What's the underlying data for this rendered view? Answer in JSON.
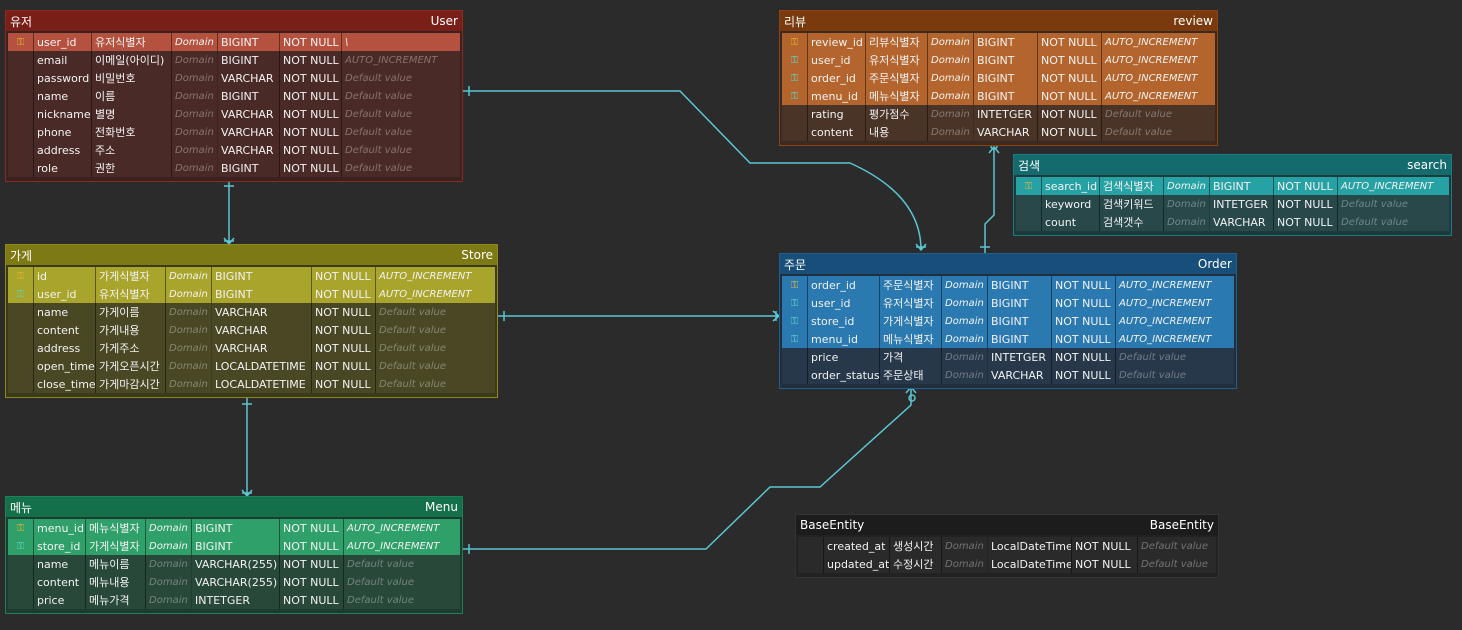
{
  "theme": {
    "user": {
      "header": "#7a1f17",
      "body": "#3a2220",
      "border": "#8c2a20",
      "key": "#b5523f",
      "col": "#4a2a27",
      "pk": "#e5b335",
      "fk": "#e5b335"
    },
    "store": {
      "header": "#7d7914",
      "body": "#3b3a1d",
      "border": "#8e8a1a",
      "key": "#a9a42c",
      "col": "#4a4824",
      "pk": "#e5b335",
      "fk": "#5fd3c9"
    },
    "menu": {
      "header": "#13704a",
      "body": "#1f3a2e",
      "border": "#1b8156",
      "key": "#2fa06a",
      "col": "#28483a",
      "pk": "#e5b335",
      "fk": "#5fd3c9"
    },
    "review": {
      "header": "#7a3a0d",
      "body": "#3a2a20",
      "border": "#8e4412",
      "key": "#b3652d",
      "col": "#4a3428",
      "pk": "#e5b335",
      "fk": "#5fd3c9"
    },
    "search": {
      "header": "#136b6d",
      "body": "#1f3a3b",
      "border": "#1a7c7e",
      "key": "#26a2a4",
      "col": "#284849",
      "pk": "#e5b335",
      "fk": "#5fd3c9"
    },
    "order": {
      "header": "#174f7a",
      "body": "#1f2f3b",
      "border": "#1e5f92",
      "key": "#2a79b0",
      "col": "#27384a",
      "pk": "#e5b335",
      "fk": "#5fd3c9"
    },
    "base": {
      "header": "#1c1c1c",
      "body": "#222222",
      "border": "#333333",
      "key": "#2f2f2f",
      "col": "#2a2a2a",
      "pk": "#888888",
      "fk": "#888888"
    },
    "line": "#5bc6d1"
  },
  "entities": [
    {
      "id": "user",
      "label_ko": "유저",
      "label_en": "User",
      "rows": [
        {
          "key": "pk",
          "name": "user_id",
          "logical": "유저식별자",
          "domain": "Domain",
          "type": "BIGINT",
          "null": "NOT NULL",
          "default": "\\"
        },
        {
          "key": "",
          "name": "email",
          "logical": "이메일(아이디)",
          "domain": "Domain",
          "type": "BIGINT",
          "null": "NOT NULL",
          "default": "AUTO_INCREMENT"
        },
        {
          "key": "",
          "name": "password",
          "logical": "비밀번호",
          "domain": "Domain",
          "type": "VARCHAR",
          "null": "NOT NULL",
          "default": "Default value"
        },
        {
          "key": "",
          "name": "name",
          "logical": "이름",
          "domain": "Domain",
          "type": "BIGINT",
          "null": "NOT NULL",
          "default": "Default value"
        },
        {
          "key": "",
          "name": "nickname",
          "logical": "별명",
          "domain": "Domain",
          "type": "VARCHAR",
          "null": "NOT NULL",
          "default": "Default value"
        },
        {
          "key": "",
          "name": "phone",
          "logical": "전화번호",
          "domain": "Domain",
          "type": "VARCHAR",
          "null": "NOT NULL",
          "default": "Default value"
        },
        {
          "key": "",
          "name": "address",
          "logical": "주소",
          "domain": "Domain",
          "type": "VARCHAR",
          "null": "NOT NULL",
          "default": "Default value"
        },
        {
          "key": "",
          "name": "role",
          "logical": "권한",
          "domain": "Domain",
          "type": "BIGINT",
          "null": "NOT NULL",
          "default": "Default value"
        }
      ]
    },
    {
      "id": "store",
      "label_ko": "가게",
      "label_en": "Store",
      "rows": [
        {
          "key": "pk",
          "name": "id",
          "logical": "가게식별자",
          "domain": "Domain",
          "type": "BIGINT",
          "null": "NOT NULL",
          "default": "AUTO_INCREMENT"
        },
        {
          "key": "fk",
          "name": "user_id",
          "logical": "유저식별자",
          "domain": "Domain",
          "type": "BIGINT",
          "null": "NOT NULL",
          "default": "AUTO_INCREMENT"
        },
        {
          "key": "",
          "name": "name",
          "logical": "가게이름",
          "domain": "Domain",
          "type": "VARCHAR",
          "null": "NOT NULL",
          "default": "Default value"
        },
        {
          "key": "",
          "name": "content",
          "logical": "가게내용",
          "domain": "Domain",
          "type": "VARCHAR",
          "null": "NOT NULL",
          "default": "Default value"
        },
        {
          "key": "",
          "name": "address",
          "logical": "가게주소",
          "domain": "Domain",
          "type": "VARCHAR",
          "null": "NOT NULL",
          "default": "Default value"
        },
        {
          "key": "",
          "name": "open_time",
          "logical": "가게오픈시간",
          "domain": "Domain",
          "type": "LOCALDATETIME",
          "null": "NOT NULL",
          "default": "Default value"
        },
        {
          "key": "",
          "name": "close_time",
          "logical": "가게마감시간",
          "domain": "Domain",
          "type": "LOCALDATETIME",
          "null": "NOT NULL",
          "default": "Default value"
        }
      ]
    },
    {
      "id": "menu",
      "label_ko": "메뉴",
      "label_en": "Menu",
      "rows": [
        {
          "key": "pk",
          "name": "menu_id",
          "logical": "메뉴식별자",
          "domain": "Domain",
          "type": "BIGINT",
          "null": "NOT NULL",
          "default": "AUTO_INCREMENT"
        },
        {
          "key": "fk",
          "name": "store_id",
          "logical": "가게식별자",
          "domain": "Domain",
          "type": "BIGINT",
          "null": "NOT NULL",
          "default": "AUTO_INCREMENT"
        },
        {
          "key": "",
          "name": "name",
          "logical": "메뉴이름",
          "domain": "Domain",
          "type": "VARCHAR(255)",
          "null": "NOT NULL",
          "default": "Default value"
        },
        {
          "key": "",
          "name": "content",
          "logical": "메뉴내용",
          "domain": "Domain",
          "type": "VARCHAR(255)",
          "null": "NOT NULL",
          "default": "Default value"
        },
        {
          "key": "",
          "name": "price",
          "logical": "메뉴가격",
          "domain": "Domain",
          "type": "INTETGER",
          "null": "NOT NULL",
          "default": "Default value"
        }
      ]
    },
    {
      "id": "review",
      "label_ko": "리뷰",
      "label_en": "review",
      "rows": [
        {
          "key": "pk",
          "name": "review_id",
          "logical": "리뷰식별자",
          "domain": "Domain",
          "type": "BIGINT",
          "null": "NOT NULL",
          "default": "AUTO_INCREMENT"
        },
        {
          "key": "fk",
          "name": "user_id",
          "logical": "유저식별자",
          "domain": "Domain",
          "type": "BIGINT",
          "null": "NOT NULL",
          "default": "AUTO_INCREMENT"
        },
        {
          "key": "fk",
          "name": "order_id",
          "logical": "주문식별자",
          "domain": "Domain",
          "type": "BIGINT",
          "null": "NOT NULL",
          "default": "AUTO_INCREMENT"
        },
        {
          "key": "fk",
          "name": "menu_id",
          "logical": "메뉴식별자",
          "domain": "Domain",
          "type": "BIGINT",
          "null": "NOT NULL",
          "default": "AUTO_INCREMENT"
        },
        {
          "key": "",
          "name": "rating",
          "logical": "평가점수",
          "domain": "Domain",
          "type": "INTETGER",
          "null": "NOT NULL",
          "default": "Default value"
        },
        {
          "key": "",
          "name": "content",
          "logical": "내용",
          "domain": "Domain",
          "type": "VARCHAR",
          "null": "NOT NULL",
          "default": "Default value"
        }
      ]
    },
    {
      "id": "search",
      "label_ko": "검색",
      "label_en": "search",
      "rows": [
        {
          "key": "pk",
          "name": "search_id",
          "logical": "검색식별자",
          "domain": "Domain",
          "type": "BIGINT",
          "null": "NOT NULL",
          "default": "AUTO_INCREMENT"
        },
        {
          "key": "",
          "name": "keyword",
          "logical": "검색키워드",
          "domain": "Domain",
          "type": "INTETGER",
          "null": "NOT NULL",
          "default": "Default value"
        },
        {
          "key": "",
          "name": "count",
          "logical": "검색갯수",
          "domain": "Domain",
          "type": "VARCHAR",
          "null": "NOT NULL",
          "default": "Default value"
        }
      ]
    },
    {
      "id": "order",
      "label_ko": "주문",
      "label_en": "Order",
      "rows": [
        {
          "key": "pk",
          "name": "order_id",
          "logical": "주문식별자",
          "domain": "Domain",
          "type": "BIGINT",
          "null": "NOT NULL",
          "default": "AUTO_INCREMENT"
        },
        {
          "key": "fk",
          "name": "user_id",
          "logical": "유저식별자",
          "domain": "Domain",
          "type": "BIGINT",
          "null": "NOT NULL",
          "default": "AUTO_INCREMENT"
        },
        {
          "key": "fk",
          "name": "store_id",
          "logical": "가게식별자",
          "domain": "Domain",
          "type": "BIGINT",
          "null": "NOT NULL",
          "default": "AUTO_INCREMENT"
        },
        {
          "key": "fk",
          "name": "menu_id",
          "logical": "메뉴식별자",
          "domain": "Domain",
          "type": "BIGINT",
          "null": "NOT NULL",
          "default": "AUTO_INCREMENT"
        },
        {
          "key": "",
          "name": "price",
          "logical": "가격",
          "domain": "Domain",
          "type": "INTETGER",
          "null": "NOT NULL",
          "default": "Default value"
        },
        {
          "key": "",
          "name": "order_status",
          "logical": "주문상태",
          "domain": "Domain",
          "type": "VARCHAR",
          "null": "NOT NULL",
          "default": "Default value"
        }
      ]
    },
    {
      "id": "base",
      "label_ko": "BaseEntity",
      "label_en": "BaseEntity",
      "rows": [
        {
          "key": "",
          "name": "created_at",
          "logical": "생성시간",
          "domain": "Domain",
          "type": "LocalDateTime",
          "null": "NOT NULL",
          "default": "Default value"
        },
        {
          "key": "",
          "name": "updated_at",
          "logical": "수정시간",
          "domain": "Domain",
          "type": "LocalDateTime",
          "null": "NOT NULL",
          "default": "Default value"
        }
      ]
    }
  ]
}
